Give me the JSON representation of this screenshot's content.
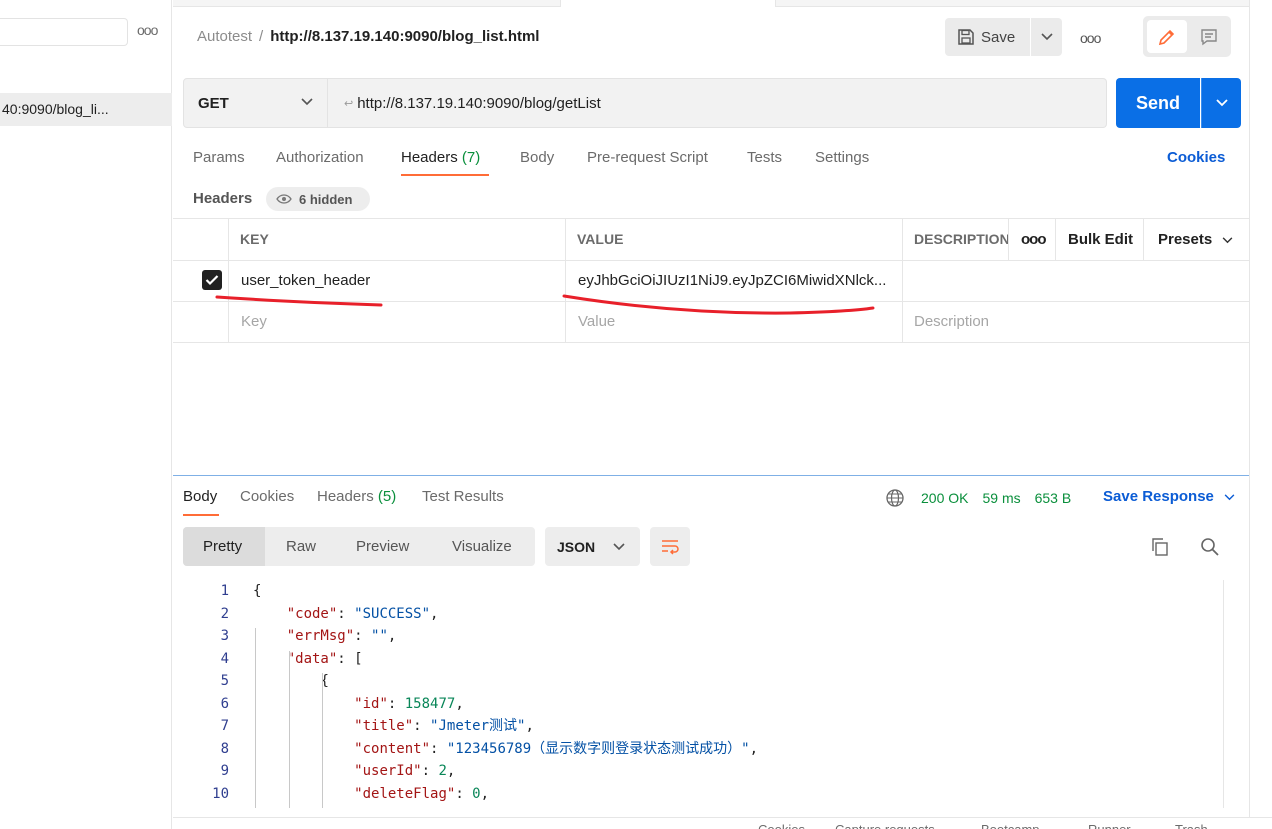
{
  "sidebar": {
    "more_label": "ooo",
    "active_item": "40:9090/blog_li..."
  },
  "header": {
    "breadcrumb_parent": "Autotest",
    "breadcrumb_separator": "/",
    "breadcrumb_current": "http://8.137.19.140:9090/blog_list.html",
    "save_label": "Save",
    "more_label": "ooo"
  },
  "request": {
    "method": "GET",
    "url_arrow": "↩",
    "url": "http://8.137.19.140:9090/blog/getList",
    "send_label": "Send",
    "tabs": [
      {
        "label": "Params"
      },
      {
        "label": "Authorization"
      },
      {
        "label": "Headers",
        "count": "(7)"
      },
      {
        "label": "Body"
      },
      {
        "label": "Pre-request Script"
      },
      {
        "label": "Tests"
      },
      {
        "label": "Settings"
      }
    ],
    "cookies_label": "Cookies",
    "headers_label": "Headers",
    "hidden_label": "6 hidden"
  },
  "headers_table": {
    "columns": {
      "key": "KEY",
      "value": "VALUE",
      "description": "DESCRIPTION",
      "more": "ooo",
      "bulk_edit": "Bulk Edit",
      "presets": "Presets"
    },
    "rows": [
      {
        "checked": true,
        "key": "user_token_header",
        "value": "eyJhbGciOiJIUzI1NiJ9.eyJpZCI6MiwidXNlck..."
      }
    ],
    "placeholders": {
      "key": "Key",
      "value": "Value",
      "description": "Description"
    }
  },
  "response": {
    "tabs": [
      {
        "label": "Body"
      },
      {
        "label": "Cookies"
      },
      {
        "label": "Headers",
        "count": "(5)"
      },
      {
        "label": "Test Results"
      }
    ],
    "status": "200 OK",
    "time": "59 ms",
    "size": "653 B",
    "save_response_label": "Save Response",
    "view_modes": [
      "Pretty",
      "Raw",
      "Preview",
      "Visualize"
    ],
    "format": "JSON",
    "code_lines": [
      {
        "n": "1",
        "indent": 0,
        "parts": [
          [
            "p",
            "{"
          ]
        ]
      },
      {
        "n": "2",
        "indent": 1,
        "parts": [
          [
            "k",
            "\"code\""
          ],
          [
            "p",
            ": "
          ],
          [
            "s",
            "\"SUCCESS\""
          ],
          [
            "p",
            ","
          ]
        ]
      },
      {
        "n": "3",
        "indent": 1,
        "parts": [
          [
            "k",
            "\"errMsg\""
          ],
          [
            "p",
            ": "
          ],
          [
            "s",
            "\"\""
          ],
          [
            "p",
            ","
          ]
        ]
      },
      {
        "n": "4",
        "indent": 1,
        "parts": [
          [
            "k",
            "\"data\""
          ],
          [
            "p",
            ": ["
          ]
        ]
      },
      {
        "n": "5",
        "indent": 2,
        "parts": [
          [
            "p",
            "{"
          ]
        ]
      },
      {
        "n": "6",
        "indent": 3,
        "parts": [
          [
            "k",
            "\"id\""
          ],
          [
            "p",
            ": "
          ],
          [
            "n",
            "158477"
          ],
          [
            "p",
            ","
          ]
        ]
      },
      {
        "n": "7",
        "indent": 3,
        "parts": [
          [
            "k",
            "\"title\""
          ],
          [
            "p",
            ": "
          ],
          [
            "s",
            "\"Jmeter测试\""
          ],
          [
            "p",
            ","
          ]
        ]
      },
      {
        "n": "8",
        "indent": 3,
        "parts": [
          [
            "k",
            "\"content\""
          ],
          [
            "p",
            ": "
          ],
          [
            "s",
            "\"123456789（显示数字则登录状态测试成功）\""
          ],
          [
            "p",
            ","
          ]
        ]
      },
      {
        "n": "9",
        "indent": 3,
        "parts": [
          [
            "k",
            "\"userId\""
          ],
          [
            "p",
            ": "
          ],
          [
            "n",
            "2"
          ],
          [
            "p",
            ","
          ]
        ]
      },
      {
        "n": "10",
        "indent": 3,
        "parts": [
          [
            "k",
            "\"deleteFlag\""
          ],
          [
            "p",
            ": "
          ],
          [
            "n",
            "0"
          ],
          [
            "p",
            ","
          ]
        ]
      }
    ]
  },
  "footer": {
    "items": [
      "Cookies",
      "Capture requests",
      "Bootcamp",
      "Runner",
      "Trash"
    ]
  },
  "colors": {
    "accent_orange": "#ff6c37",
    "primary_blue": "#0a6fe6",
    "status_green": "#0a8f3c",
    "annotation_red": "#e8202a"
  }
}
